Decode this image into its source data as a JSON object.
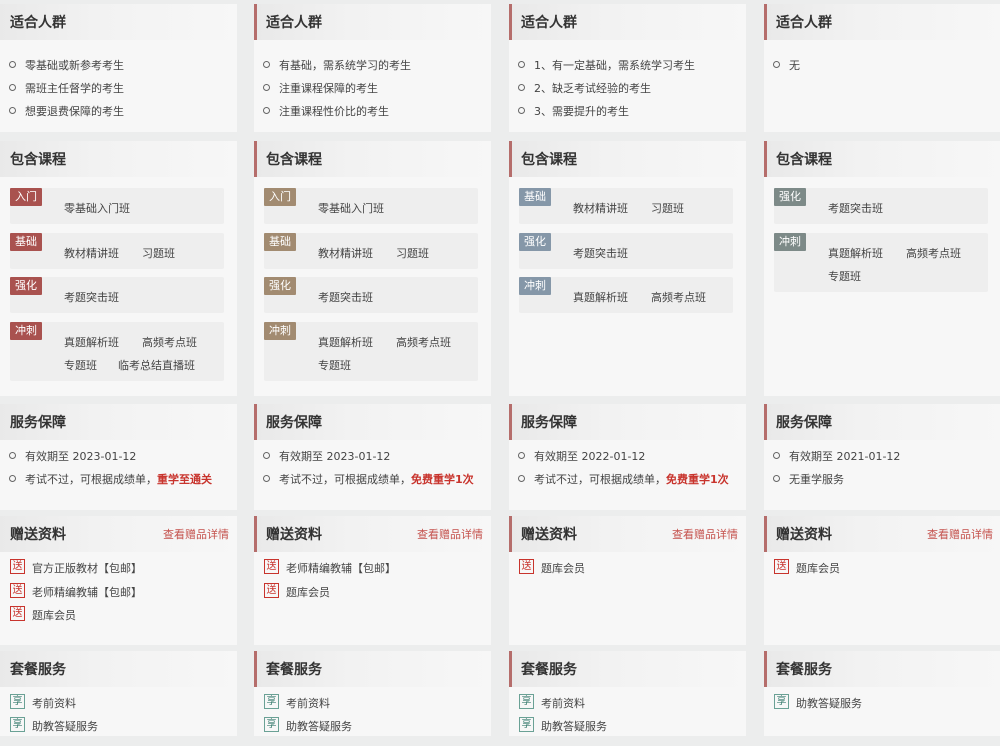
{
  "colors": {
    "tag_dark_red": "#a9524f",
    "tag_tan": "#a28b71",
    "tag_slate": "#8597a8",
    "tag_teal_gray": "#7d8a88",
    "highlight_red": "#c8342d",
    "link_red": "#c4504b",
    "accent_bar": "#b56d6b",
    "gift_icon": "#c8342d",
    "pkg_icon": "#3a7e70"
  },
  "icons": {
    "gift": "送",
    "pkg": "享"
  },
  "section_titles": {
    "crowd": "适合人群",
    "courses": "包含课程",
    "service": "服务保障",
    "gifts": "赠送资料",
    "package": "套餐服务"
  },
  "gift_link": "查看赠品详情",
  "cols": [
    {
      "crowd": [
        "零基础或新参考考生",
        "需班主任督学的考生",
        "想要退费保障的考生"
      ],
      "courses": [
        {
          "tag": "入门",
          "items": [
            "零基础入门班"
          ]
        },
        {
          "tag": "基础",
          "items": [
            "教材精讲班",
            "习题班"
          ]
        },
        {
          "tag": "强化",
          "items": [
            "考题突击班"
          ]
        },
        {
          "tag": "冲刺",
          "items": [
            "真题解析班",
            "高频考点班",
            "专题班",
            "临考总结直播班"
          ]
        }
      ],
      "service": {
        "validity": "有效期至 2023-01-12",
        "guarantee": "考试不过，可根据成绩单，",
        "guarantee_highlight": "重学至通关"
      },
      "gifts": [
        "官方正版教材【包邮】",
        "老师精编教辅【包邮】",
        "题库会员"
      ],
      "package": [
        "考前资料",
        "助教答疑服务"
      ]
    },
    {
      "crowd": [
        "有基础，需系统学习的考生",
        "注重课程保障的考生",
        "注重课程性价比的考生"
      ],
      "courses": [
        {
          "tag": "入门",
          "items": [
            "零基础入门班"
          ]
        },
        {
          "tag": "基础",
          "items": [
            "教材精讲班",
            "习题班"
          ]
        },
        {
          "tag": "强化",
          "items": [
            "考题突击班"
          ]
        },
        {
          "tag": "冲刺",
          "items": [
            "真题解析班",
            "高频考点班",
            "专题班"
          ]
        }
      ],
      "service": {
        "validity": "有效期至 2023-01-12",
        "guarantee": "考试不过，可根据成绩单，",
        "guarantee_highlight": "免费重学1次"
      },
      "gifts": [
        "老师精编教辅【包邮】",
        "题库会员"
      ],
      "package": [
        "考前资料",
        "助教答疑服务"
      ]
    },
    {
      "crowd": [
        "1、有一定基础，需系统学习考生",
        "2、缺乏考试经验的考生",
        "3、需要提升的考生"
      ],
      "courses": [
        {
          "tag": "基础",
          "items": [
            "教材精讲班",
            "习题班"
          ]
        },
        {
          "tag": "强化",
          "items": [
            "考题突击班"
          ]
        },
        {
          "tag": "冲刺",
          "items": [
            "真题解析班",
            "高频考点班"
          ]
        }
      ],
      "service": {
        "validity": "有效期至 2022-01-12",
        "guarantee": "考试不过，可根据成绩单，",
        "guarantee_highlight": "免费重学1次"
      },
      "gifts": [
        "题库会员"
      ],
      "package": [
        "考前资料",
        "助教答疑服务"
      ]
    },
    {
      "crowd": [
        "无"
      ],
      "courses": [
        {
          "tag": "强化",
          "items": [
            "考题突击班"
          ]
        },
        {
          "tag": "冲刺",
          "items": [
            "真题解析班",
            "高频考点班",
            "专题班"
          ]
        }
      ],
      "service": {
        "validity": "有效期至 2021-01-12",
        "guarantee": "无重学服务",
        "guarantee_highlight": ""
      },
      "gifts": [
        "题库会员"
      ],
      "package": [
        "助教答疑服务"
      ]
    }
  ]
}
